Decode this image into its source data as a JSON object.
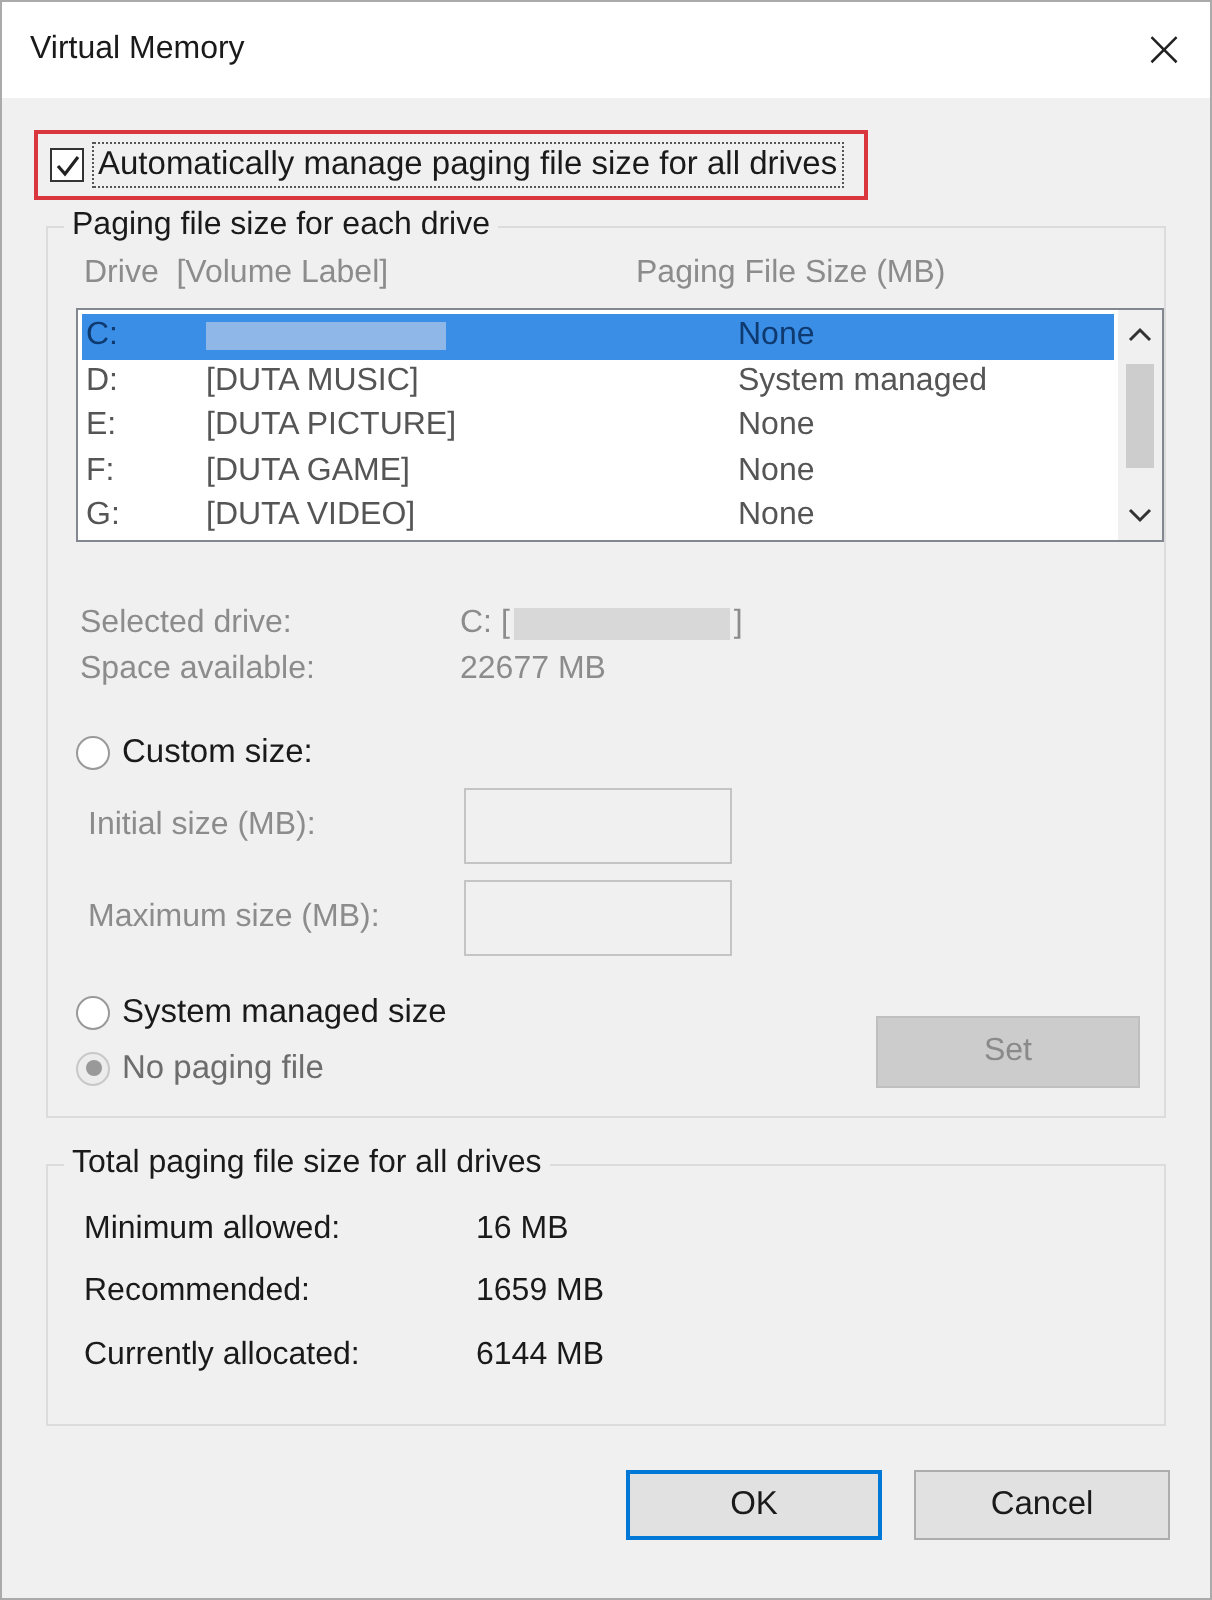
{
  "window": {
    "title": "Virtual Memory",
    "close": "×"
  },
  "auto_manage": {
    "label": "Automatically manage paging file size for all drives",
    "checked": true,
    "highlighted": true
  },
  "drives_group": {
    "title": "Paging file size for each drive",
    "disabled": true,
    "columns": [
      "Drive  [Volume Label]",
      "Paging File Size (MB)"
    ],
    "rows": [
      {
        "drive": "C:",
        "label": "",
        "size": "None",
        "redacted": true,
        "selected": true
      },
      {
        "drive": "D:",
        "label": "[DUTA MUSIC]",
        "size": "System managed",
        "redacted": false,
        "selected": false
      },
      {
        "drive": "E:",
        "label": "[DUTA PICTURE]",
        "size": "None",
        "redacted": false,
        "selected": false
      },
      {
        "drive": "F:",
        "label": "[DUTA GAME]",
        "size": "None",
        "redacted": false,
        "selected": false
      },
      {
        "drive": "G:",
        "label": "[DUTA VIDEO]",
        "size": "None",
        "redacted": false,
        "selected": false
      }
    ],
    "selected_drive": {
      "label": "Selected drive:",
      "value_prefix": "C: [",
      "value_suffix": "]"
    },
    "space_available": {
      "label": "Space available:",
      "value": "22677 MB"
    },
    "options": [
      {
        "kind": "radio",
        "label": "Custom size:",
        "selected": false,
        "disabled": false
      },
      {
        "kind": "field",
        "label": "Initial size (MB):"
      },
      {
        "kind": "field",
        "label": "Maximum size (MB):"
      },
      {
        "kind": "radio",
        "label": "System managed size",
        "selected": false,
        "disabled": false
      },
      {
        "kind": "radio",
        "label": "No paging file",
        "selected": true,
        "disabled": true
      }
    ],
    "set_button": {
      "label": "Set",
      "disabled": true
    }
  },
  "totals_group": {
    "title": "Total paging file size for all drives",
    "rows": [
      {
        "label": "Minimum allowed:",
        "value": "16 MB"
      },
      {
        "label": "Recommended:",
        "value": "1659 MB"
      },
      {
        "label": "Currently allocated:",
        "value": "6144 MB"
      }
    ]
  },
  "buttons": [
    {
      "label": "OK",
      "default": true
    },
    {
      "label": "Cancel",
      "default": false
    }
  ]
}
